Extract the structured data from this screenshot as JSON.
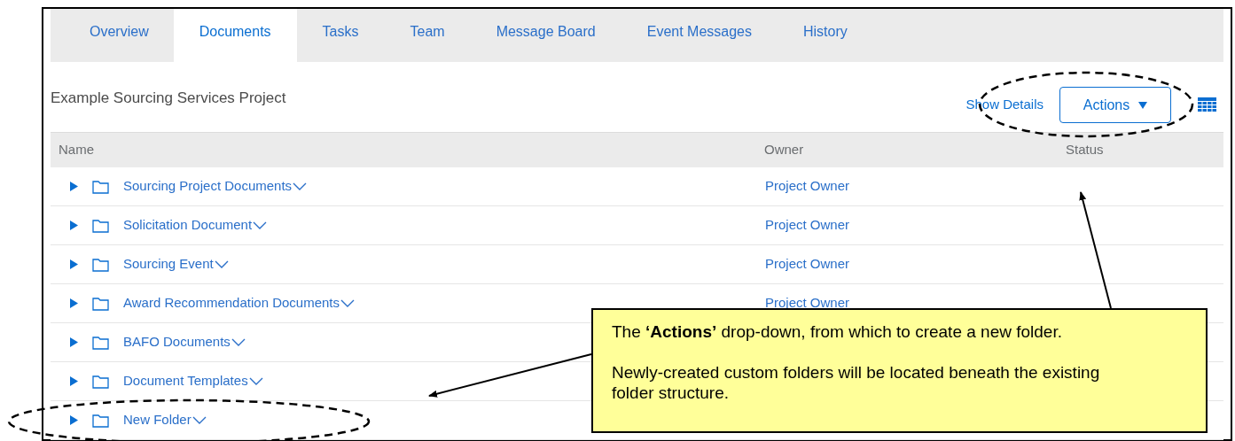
{
  "tabs": [
    {
      "label": "Overview",
      "selected": false
    },
    {
      "label": "Documents",
      "selected": true
    },
    {
      "label": "Tasks",
      "selected": false
    },
    {
      "label": "Team",
      "selected": false
    },
    {
      "label": "Message Board",
      "selected": false
    },
    {
      "label": "Event Messages",
      "selected": false
    },
    {
      "label": "History",
      "selected": false
    }
  ],
  "project_title": "Example Sourcing Services Project",
  "toolbar": {
    "show_details": "Show Details",
    "actions_button": "Actions"
  },
  "table": {
    "columns": [
      "Name",
      "Owner",
      "Status"
    ],
    "rows": [
      {
        "name": "Sourcing Project Documents",
        "owner": "Project Owner"
      },
      {
        "name": "Solicitation Document",
        "owner": "Project Owner"
      },
      {
        "name": "Sourcing Event",
        "owner": "Project Owner"
      },
      {
        "name": "Award Recommendation Documents",
        "owner": "Project Owner"
      },
      {
        "name": "BAFO Documents"
      },
      {
        "name": "Document Templates"
      },
      {
        "name": "New Folder"
      }
    ]
  },
  "callout": {
    "paragraphs": [
      "The **‘Actions’** drop-down, from which to create a new folder.",
      "Newly-created custom folders will be located beneath the existing folder structure."
    ]
  }
}
